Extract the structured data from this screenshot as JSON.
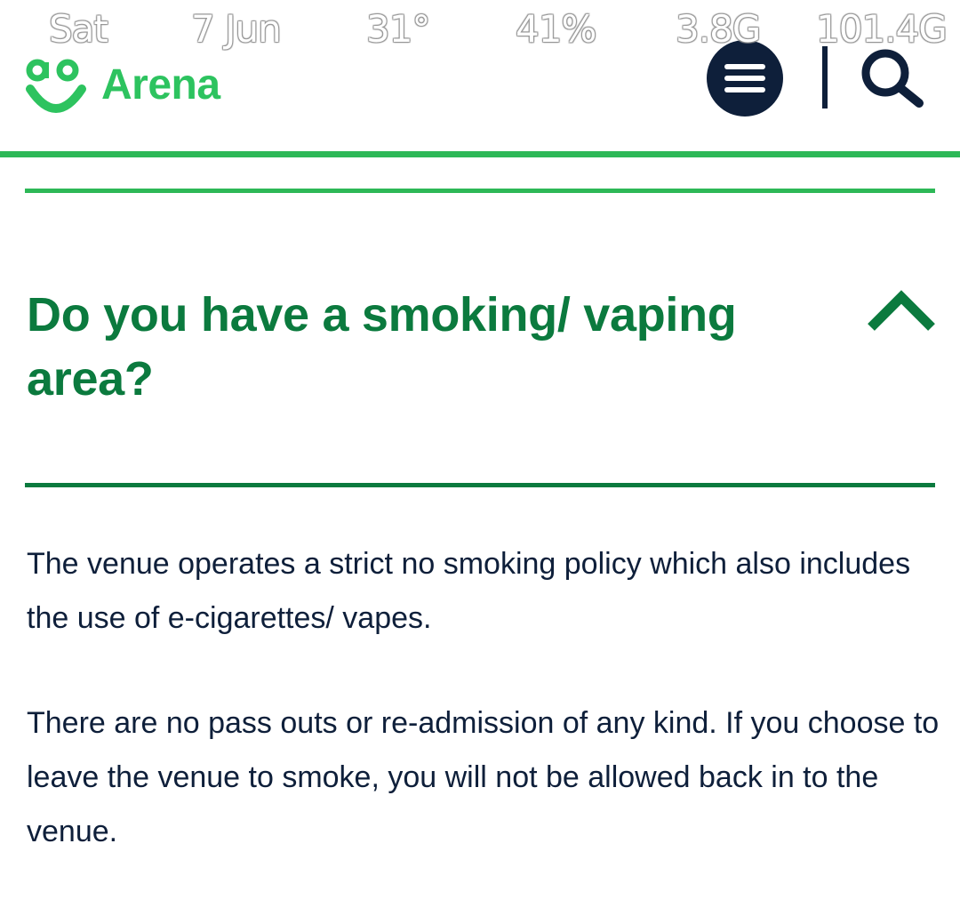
{
  "status_bar": {
    "day": "Sat",
    "date": "7 Jun",
    "temperature": "31°",
    "battery": "41%",
    "network_1": "3.8G",
    "network_2": "101.4G"
  },
  "header": {
    "logo_text": "Arena",
    "logo_mark": "ao",
    "menu_icon": "hamburger-menu-icon",
    "search_icon": "search-icon"
  },
  "colors": {
    "brand_green": "#2dc35f",
    "rule_green": "#2db857",
    "question_green": "#0b7a3e",
    "navy": "#0e1f3a"
  },
  "faq": {
    "question": "Do you have a smoking/ vaping area?",
    "expanded": true,
    "answer_paragraphs": [
      "The venue operates a strict no smoking policy which also includes the use of e-cigarettes/ vapes.",
      "There are no pass outs or re-admission of any kind. If you choose to leave the venue to smoke, you will not be allowed back in to the venue."
    ]
  }
}
